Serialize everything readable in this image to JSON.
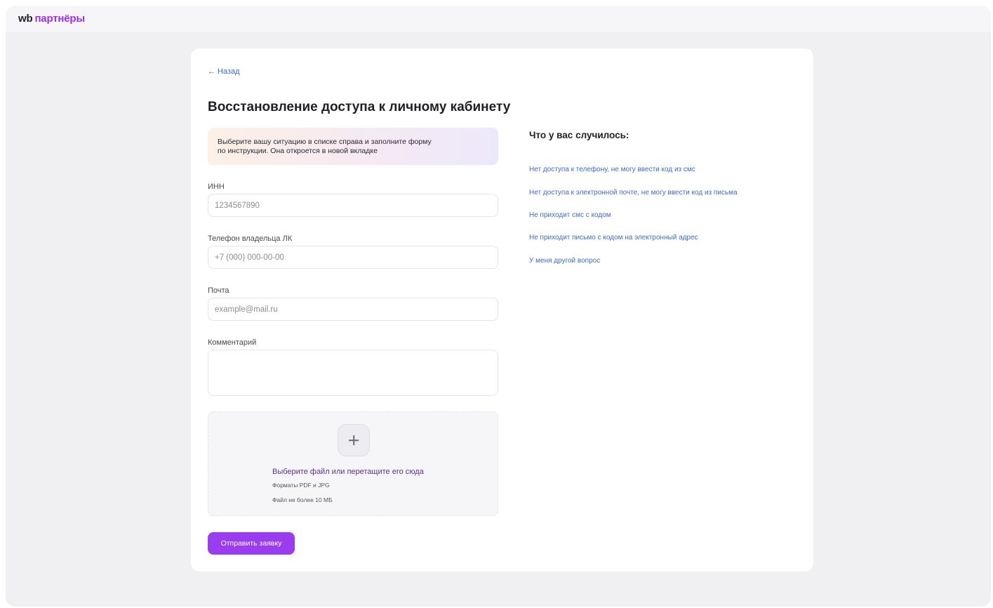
{
  "header": {
    "logo_wb": "wb",
    "logo_partners": "партнёры"
  },
  "back": {
    "arrow": "←",
    "label": "Назад"
  },
  "page_title": "Восстановление доступа к личному кабинету",
  "banner": {
    "line1": "Выберите вашу ситуацию в списке справа и заполните форму",
    "line2": "по инструкции. Она откроется в новой вкладке"
  },
  "form": {
    "inn": {
      "label": "ИНН",
      "placeholder": "1234567890"
    },
    "phone": {
      "label": "Телефон владельца ЛК",
      "placeholder": "+7 (000) 000-00-00"
    },
    "email": {
      "label": "Почта",
      "placeholder": "example@mail.ru"
    },
    "comment": {
      "label": "Комментарий",
      "placeholder": ""
    }
  },
  "upload": {
    "title": "Выберите файл или перетащите его сюда",
    "formats": "Форматы PDF и JPG",
    "size": "Файл не более 10 МБ"
  },
  "submit_label": "Отправить заявку",
  "situations": {
    "title": "Что у вас случилось:",
    "items": [
      "Нет доступа к телефону, не могу ввести код из смс",
      "Нет доступа к электронной почте, не могу ввести код из письма",
      "Не приходит смс с кодом",
      "Не приходит письмо с кодом на электронный адрес",
      "У меня другой вопрос"
    ]
  },
  "colors": {
    "accent": "#9a3cf0",
    "link": "#3d6bd8",
    "logo_accent": "#9f2ef2",
    "background": "#f0f0f3"
  }
}
